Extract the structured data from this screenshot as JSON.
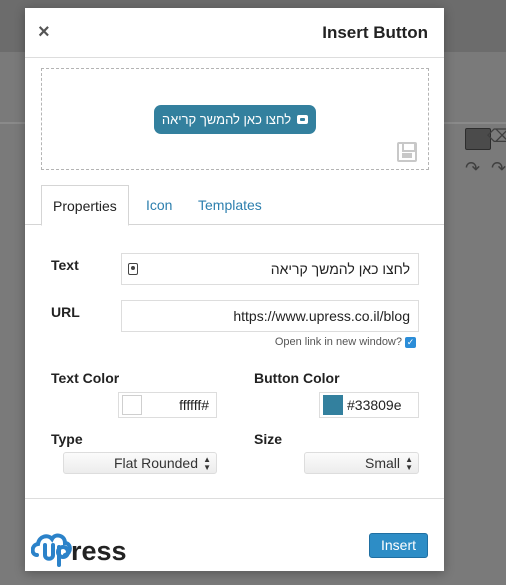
{
  "dialog": {
    "title": "Insert Button",
    "close_icon": "close-icon",
    "close_glyph": "×"
  },
  "preview": {
    "button_text": "לחצו כאן להמשך קריאה",
    "button_color": "#33809e",
    "button_icon": "newspaper-icon",
    "save_icon": "save-icon"
  },
  "tabs": [
    {
      "label": "Properties",
      "active": true
    },
    {
      "label": "Icon",
      "active": false
    },
    {
      "label": "Templates",
      "active": false
    }
  ],
  "form": {
    "text_label": "Text",
    "text_value": "לחצו כאן להמשך קריאה",
    "url_label": "URL",
    "url_value": "https://www.upress.co.il/blog",
    "new_window_label": "Open link in new window?",
    "new_window_checked": true,
    "text_color_label": "Text Color",
    "text_color_value": "ffffff#",
    "text_color_swatch": "#ffffff",
    "button_color_label": "Button Color",
    "button_color_value": "#33809e",
    "button_color_swatch": "#33809e",
    "type_label": "Type",
    "type_value": "Flat Rounded",
    "size_label": "Size",
    "size_value": "Small"
  },
  "footer": {
    "logo_text": "ress",
    "insert_label": "Insert"
  },
  "colors": {
    "accent": "#2d8dc6",
    "logo_blue": "#2b82c9"
  }
}
